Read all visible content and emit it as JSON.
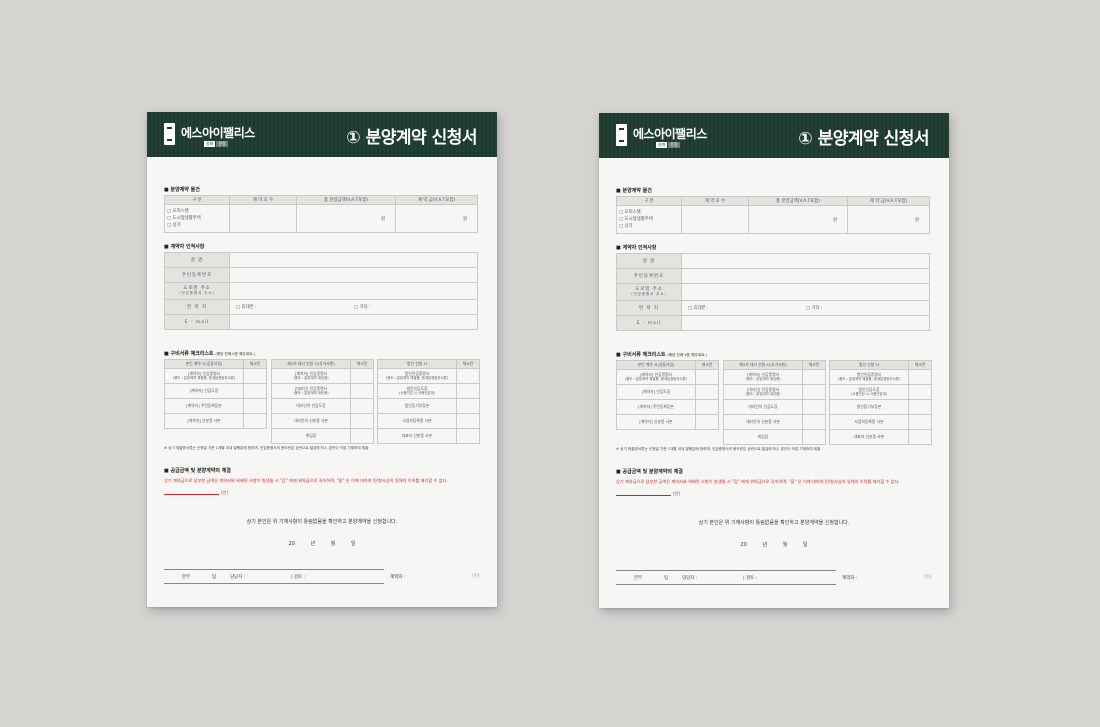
{
  "header": {
    "brand": "에스아이팰리스",
    "brand_tags": [
      "송파",
      "문정"
    ],
    "title": "① 분양계약 신청서"
  },
  "section1": {
    "heading": "분양계약 물건",
    "columns": [
      "구 분",
      "계 약 호 수",
      "총 분양금액(V.A.T포함)",
      "계 약 금(V.A.T포함)"
    ],
    "options": [
      "□ 오피스텔",
      "□ 도시형생활주택",
      "□ 상가"
    ],
    "won": "원"
  },
  "section2": {
    "heading": "계약자 인적사항",
    "rows": [
      "성 명",
      "주민등록번호",
      "도로명 주소",
      "연 락 처",
      "E - mail"
    ],
    "address_sub": "(인감증명서 주소)",
    "mobile": "□ 휴대폰 :",
    "other": "□ 기타 :"
  },
  "section3": {
    "heading": "구비서류 체크리스트",
    "heading_note": "(해당 칸에 V표 해주세요.)",
    "groups": [
      {
        "title": "본인 계약 시(공동사업)",
        "check": "체크란",
        "items": [
          {
            "main": "[계약자] 인감증명서",
            "sub": "(용도 : 분양계약 체결용, 등계된경등자서류)"
          },
          {
            "main": "[계약자] 인감도장",
            "sub": ""
          },
          {
            "main": "[계약자] 주민등록등본",
            "sub": ""
          },
          {
            "main": "[계약자] 신분증 사본",
            "sub": ""
          }
        ]
      },
      {
        "title": "제3자 대리 신청 시(추가사항)",
        "check": "체크란",
        "items": [
          {
            "main": "[계약자] 인감증명서",
            "sub": "(용도 : 분양계약 위임용)"
          },
          {
            "main": "[대리인] 인감증명서",
            "sub": "(용도 : 분양계약 대리용)"
          },
          {
            "main": "대리인의 인감도장",
            "sub": ""
          },
          {
            "main": "대리인의 신분증 사본",
            "sub": ""
          },
          {
            "main": "위임장",
            "sub": ""
          }
        ]
      },
      {
        "title": "법인 신청 시",
        "check": "체크란",
        "items": [
          {
            "main": "법인인감증명서",
            "sub": "(용도 : 분양계약 체결용, 등계된경등자서류)"
          },
          {
            "main": "법인인감도장",
            "sub": "(사용인감 시 사용인감계)"
          },
          {
            "main": "법인등기부등본",
            "sub": ""
          },
          {
            "main": "사업자등록증 사본",
            "sub": ""
          },
          {
            "main": "대표자 신분증 사본",
            "sub": ""
          }
        ]
      }
    ],
    "footnote": "※ 상기 제출명서류는 신청일 기준 1개월 이내 발행분에 한하며, 인감증명서의 용도란은 공란으로 발급하거나, 본인이 직접 기재하여 제출"
  },
  "section4": {
    "heading": "공급금액 및 분양계약의 체결",
    "terms": "상기 계약금으로 납부한 금액은 계약서와 위배된 사항이 발생될 시 \"갑\" 에게 위약금으로 귀속하며, \"을\" 은 이에 대하여 민/형사상의 일체의 이의를 제기할 수 없다.",
    "sign_suffix": "(인)"
  },
  "confirm": "상기 본인은 위 기재사항이 틀림없음을 확인하고 분양계약을 신청합니다.",
  "date": "20 년 월 일",
  "footer": {
    "dept": "본부",
    "team": "팀",
    "manager": "담당자 :",
    "reviewer": "| 검토 :",
    "contractor": "계약자 :",
    "seal": "(인)"
  }
}
